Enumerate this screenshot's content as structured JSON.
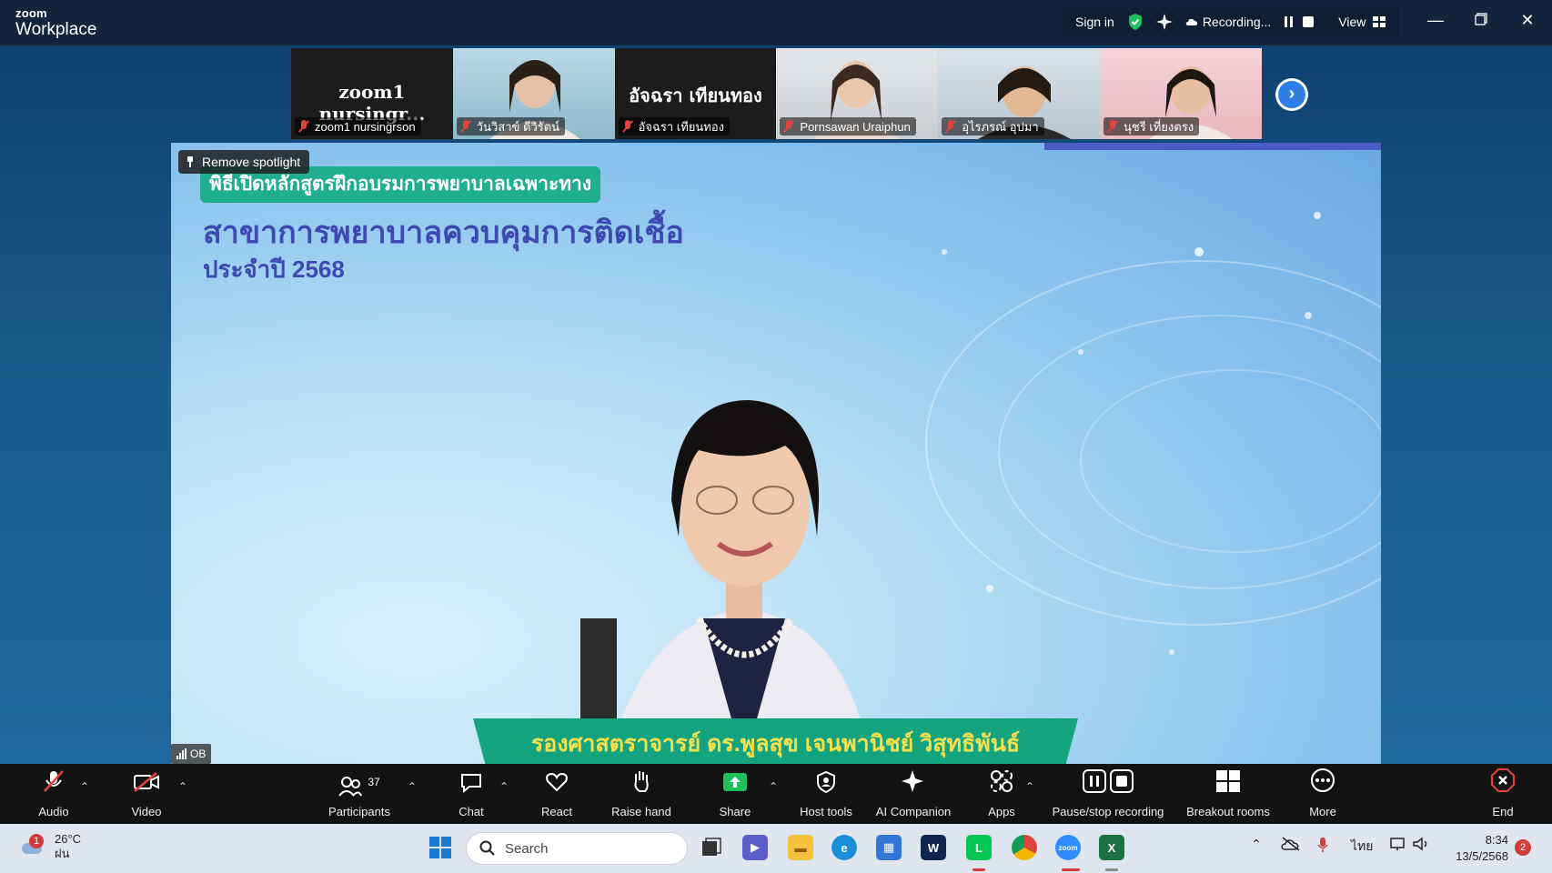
{
  "app": {
    "brand_top": "zoom",
    "brand_main": "Workplace"
  },
  "titlebar": {
    "sign_in": "Sign in",
    "recording": "Recording...",
    "view": "View"
  },
  "participants_strip": [
    {
      "big_name": "zoom1 nursingr...",
      "label": "zoom1 nursingrson",
      "video": false
    },
    {
      "big_name": "",
      "label": "วันวิสาข์ ดีวิรัตน์",
      "video": true,
      "bg": "#9fc7d8"
    },
    {
      "big_name": "อัจฉรา เทียนทอง",
      "label": "อัจฉรา เทียนทอง",
      "video": false
    },
    {
      "big_name": "",
      "label": "Pornsawan Uraiphun",
      "video": true,
      "bg": "#d9dde1"
    },
    {
      "big_name": "",
      "label": "อุไรภรณ์ อุปมา",
      "video": true,
      "bg": "#c6d3dc"
    },
    {
      "big_name": "",
      "label": "นุชรี เที่ยงตรง",
      "video": true,
      "bg": "#f1c8cf"
    }
  ],
  "main": {
    "remove_spotlight": "Remove spotlight",
    "slide_line1": "พิธีเปิดหลักสูตรฝึกอบรมการพยาบาลเฉพาะทาง",
    "slide_line2": "สาขาการพยาบาลควบคุมการติดเชื้อ",
    "slide_line3": "ประจำปี 2568",
    "presenter_name": "รองศาสตราจารย์ ดร.พูลสุข เจนพานิชย์ วิสุทธิพันธ์",
    "badge": "OB"
  },
  "controls": {
    "audio": "Audio",
    "video": "Video",
    "participants": "Participants",
    "participants_count": "37",
    "chat": "Chat",
    "react": "React",
    "raise_hand": "Raise hand",
    "share": "Share",
    "host_tools": "Host tools",
    "ai_companion": "AI Companion",
    "apps": "Apps",
    "pause_stop": "Pause/stop recording",
    "breakout": "Breakout rooms",
    "more": "More",
    "end": "End"
  },
  "taskbar": {
    "temp": "26°C",
    "weather": "ฝน",
    "weather_badge": "1",
    "search": "Search",
    "lang": "ไทย",
    "time": "8:34",
    "date": "13/5/2568",
    "notif_count": "2"
  }
}
